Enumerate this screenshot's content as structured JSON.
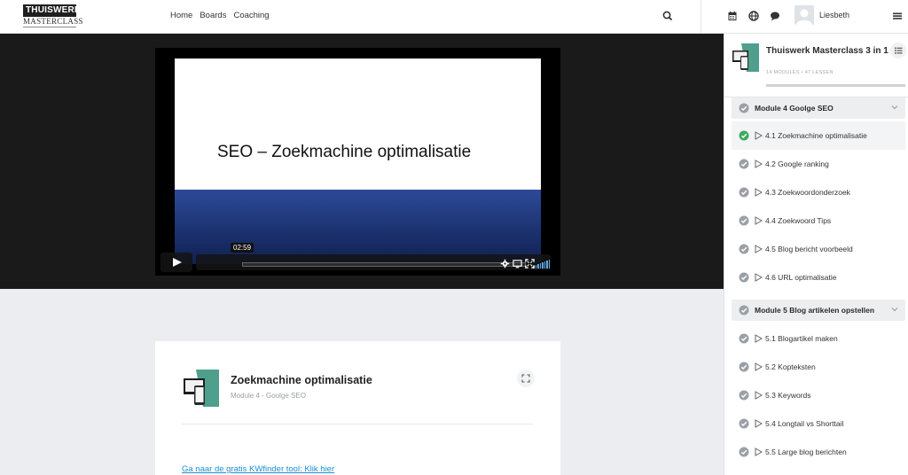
{
  "header": {
    "logo_top": "THUISWERK",
    "logo_bottom": "MASTERCLASS",
    "nav": [
      "Home",
      "Boards",
      "Coaching"
    ],
    "user_name": "Liesbeth",
    "icons": [
      "search-icon",
      "calendar-icon",
      "globe-icon",
      "chat-icon",
      "hamburger-menu-icon"
    ]
  },
  "video": {
    "slide_title": "SEO – Zoekmachine optimalisatie",
    "time": "02:59",
    "progress": 0.0,
    "colors": {
      "band": "#1c3270",
      "volume": "#5fa8e6"
    }
  },
  "lesson_card": {
    "title": "Zoekmachine optimalisatie",
    "subtitle": "Module 4 - Goolge SEO",
    "link_text": "Ga naar de gratis KWfinder tool: Klik hier"
  },
  "sidebar": {
    "course_title": "Thuiswerk Masterclass 3 in 1",
    "meta": "14 MODULES  •  47 LESSEN",
    "modules": [
      {
        "label": "Module 4   Goolge SEO",
        "lessons": [
          {
            "label": "4.1 Zoekmachine optimalisatie",
            "state": "complete",
            "active": true
          },
          {
            "label": "4.2 Google ranking",
            "state": "incomplete",
            "active": false
          },
          {
            "label": "4.3 Zoekwoordonderzoek",
            "state": "incomplete",
            "active": false
          },
          {
            "label": "4.4 Zoekwoord Tips",
            "state": "incomplete",
            "active": false
          },
          {
            "label": "4.5 Blog bericht voorbeeld",
            "state": "incomplete",
            "active": false
          },
          {
            "label": "4.6 URL optimalisatie",
            "state": "incomplete",
            "active": false
          }
        ]
      },
      {
        "label": "Module 5   Blog artikelen opstellen",
        "lessons": [
          {
            "label": "5.1 Blogartikel maken",
            "state": "incomplete",
            "active": false
          },
          {
            "label": "5.2 Kopteksten",
            "state": "incomplete",
            "active": false
          },
          {
            "label": "5.3 Keywords",
            "state": "incomplete",
            "active": false
          },
          {
            "label": "5.4 Longtail vs Shorttail",
            "state": "incomplete",
            "active": false
          },
          {
            "label": "5.5 Large blog berichten",
            "state": "incomplete",
            "active": false
          }
        ]
      }
    ],
    "colors": {
      "complete": "#3dab61",
      "incomplete": "#9aa0a6"
    }
  }
}
